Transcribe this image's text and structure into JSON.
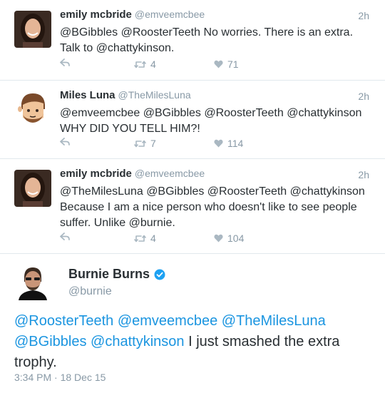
{
  "colors": {
    "link": "#1b95e0",
    "muted": "#8899a6",
    "text": "#292f33",
    "verified": "#1da1f2"
  },
  "replies": [
    {
      "name": "emily mcbride",
      "handle": "@emveemcbee",
      "time": "2h",
      "text": "@BGibbles @RoosterTeeth No worries. There is an extra. Talk to @chattykinson.",
      "retweets": "4",
      "likes": "71"
    },
    {
      "name": "Miles Luna",
      "handle": "@TheMilesLuna",
      "time": "2h",
      "text": "@emveemcbee @BGibbles @RoosterTeeth @chattykinson WHY DID YOU TELL HIM?!",
      "retweets": "7",
      "likes": "114"
    },
    {
      "name": "emily mcbride",
      "handle": "@emveemcbee",
      "time": "2h",
      "text": "@TheMilesLuna @BGibbles @RoosterTeeth @chattykinson Because I am a nice person who doesn't like to see people suffer. Unlike @burnie.",
      "retweets": "4",
      "likes": "104"
    }
  ],
  "main_tweet": {
    "name": "Burnie Burns",
    "handle": "@burnie",
    "mentions": [
      "@RoosterTeeth",
      "@emveemcbee",
      "@TheMilesLuna",
      "@BGibbles",
      "@chattykinson"
    ],
    "text": "I just smashed the extra trophy.",
    "timestamp": "3:34 PM · 18 Dec 15"
  }
}
